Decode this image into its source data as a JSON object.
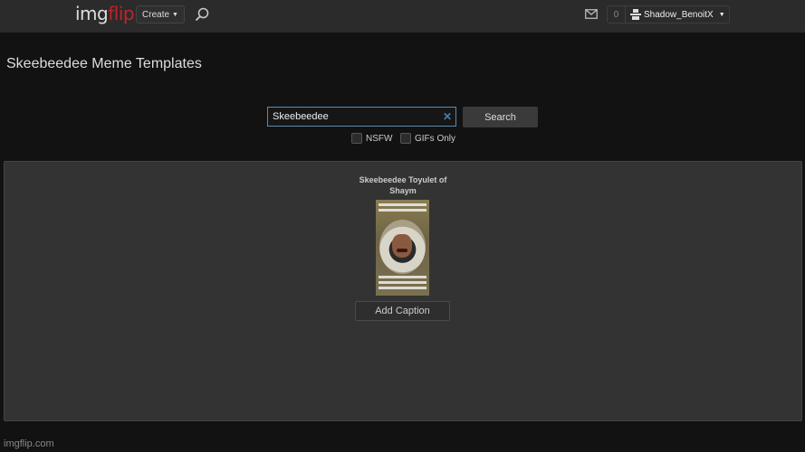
{
  "header": {
    "logo_part1": "img",
    "logo_part2": "flip",
    "create_label": "Create",
    "search_icon": "search-icon",
    "mail_icon": "mail-icon",
    "notification_count": "0",
    "username": "Shadow_BenoitX",
    "user_icon": "user-icon"
  },
  "page": {
    "title": "Skeebeedee Meme Templates"
  },
  "search": {
    "value": "Skeebeedee",
    "clear_symbol": "✕",
    "button_label": "Search",
    "nsfw_label": "NSFW",
    "gifs_label": "GIFs Only",
    "nsfw_checked": false,
    "gifs_checked": false
  },
  "results": [
    {
      "title": "Skeebeedee Toyulet of Shaym",
      "caption_button": "Add Caption"
    }
  ],
  "footer": {
    "text": "imgflip.com"
  },
  "colors": {
    "brand_red": "#c0242b",
    "accent_blue": "#4a7db5"
  }
}
